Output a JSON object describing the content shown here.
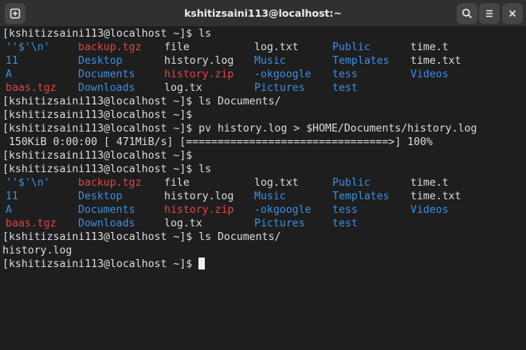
{
  "window": {
    "title": "kshitizsaini113@localhost:~",
    "buttons": [
      {
        "name": "new-tab",
        "icon": "new-tab-icon"
      },
      {
        "name": "search",
        "icon": "search-icon"
      },
      {
        "name": "menu",
        "icon": "hamburger-menu-icon"
      },
      {
        "name": "close",
        "icon": "close-icon"
      }
    ]
  },
  "colors": {
    "background": "#1e1e1e",
    "titlebar": "#303030",
    "directory": "#3c8fe0",
    "archive": "#e04545",
    "text": "#dcdcdc"
  },
  "terminal": {
    "prompt": "[kshitizsaini113@localhost ~]$",
    "lines": [
      {
        "type": "cmd",
        "text": "[kshitizsaini113@localhost ~]$ ls"
      },
      {
        "type": "ls",
        "cells": [
          {
            "text": "''$'\\n'",
            "kind": "dir"
          },
          {
            "text": "backup.tgz",
            "kind": "arc"
          },
          {
            "text": "file",
            "kind": "fil"
          },
          {
            "text": "log.txt",
            "kind": "fil"
          },
          {
            "text": "Public",
            "kind": "dir"
          },
          {
            "text": "time.t",
            "kind": "fil"
          }
        ]
      },
      {
        "type": "ls",
        "cells": [
          {
            "text": "11",
            "kind": "dir"
          },
          {
            "text": "Desktop",
            "kind": "dir"
          },
          {
            "text": "history.log",
            "kind": "fil"
          },
          {
            "text": "Music",
            "kind": "dir"
          },
          {
            "text": "Templates",
            "kind": "dir"
          },
          {
            "text": "time.txt",
            "kind": "fil"
          }
        ]
      },
      {
        "type": "ls",
        "cells": [
          {
            "text": "A",
            "kind": "dir"
          },
          {
            "text": "Documents",
            "kind": "dir"
          },
          {
            "text": "history.zip",
            "kind": "arc"
          },
          {
            "text": "-okgoogle",
            "kind": "dir"
          },
          {
            "text": "tess",
            "kind": "dir"
          },
          {
            "text": "Videos",
            "kind": "dir"
          }
        ]
      },
      {
        "type": "ls",
        "cells": [
          {
            "text": "baas.tgz",
            "kind": "arc"
          },
          {
            "text": "Downloads",
            "kind": "dir"
          },
          {
            "text": "log.tx",
            "kind": "fil"
          },
          {
            "text": "Pictures",
            "kind": "dir"
          },
          {
            "text": "test",
            "kind": "dir"
          },
          {
            "text": "",
            "kind": "fil"
          }
        ]
      },
      {
        "type": "cmd",
        "text": "[kshitizsaini113@localhost ~]$ ls Documents/"
      },
      {
        "type": "cmd",
        "text": "[kshitizsaini113@localhost ~]$"
      },
      {
        "type": "cmd",
        "text": "[kshitizsaini113@localhost ~]$ pv history.log > $HOME/Documents/history.log"
      },
      {
        "type": "cmd",
        "text": " 150KiB 0:00:00 [ 471MiB/s] [================================>] 100%"
      },
      {
        "type": "cmd",
        "text": "[kshitizsaini113@localhost ~]$"
      },
      {
        "type": "cmd",
        "text": "[kshitizsaini113@localhost ~]$ ls"
      },
      {
        "type": "ls",
        "cells": [
          {
            "text": "''$'\\n'",
            "kind": "dir"
          },
          {
            "text": "backup.tgz",
            "kind": "arc"
          },
          {
            "text": "file",
            "kind": "fil"
          },
          {
            "text": "log.txt",
            "kind": "fil"
          },
          {
            "text": "Public",
            "kind": "dir"
          },
          {
            "text": "time.t",
            "kind": "fil"
          }
        ]
      },
      {
        "type": "ls",
        "cells": [
          {
            "text": "11",
            "kind": "dir"
          },
          {
            "text": "Desktop",
            "kind": "dir"
          },
          {
            "text": "history.log",
            "kind": "fil"
          },
          {
            "text": "Music",
            "kind": "dir"
          },
          {
            "text": "Templates",
            "kind": "dir"
          },
          {
            "text": "time.txt",
            "kind": "fil"
          }
        ]
      },
      {
        "type": "ls",
        "cells": [
          {
            "text": "A",
            "kind": "dir"
          },
          {
            "text": "Documents",
            "kind": "dir"
          },
          {
            "text": "history.zip",
            "kind": "arc"
          },
          {
            "text": "-okgoogle",
            "kind": "dir"
          },
          {
            "text": "tess",
            "kind": "dir"
          },
          {
            "text": "Videos",
            "kind": "dir"
          }
        ]
      },
      {
        "type": "ls",
        "cells": [
          {
            "text": "baas.tgz",
            "kind": "arc"
          },
          {
            "text": "Downloads",
            "kind": "dir"
          },
          {
            "text": "log.tx",
            "kind": "fil"
          },
          {
            "text": "Pictures",
            "kind": "dir"
          },
          {
            "text": "test",
            "kind": "dir"
          },
          {
            "text": "",
            "kind": "fil"
          }
        ]
      },
      {
        "type": "cmd",
        "text": "[kshitizsaini113@localhost ~]$ ls Documents/"
      },
      {
        "type": "cmd",
        "text": "history.log"
      },
      {
        "type": "prompt",
        "text": "[kshitizsaini113@localhost ~]$ "
      }
    ]
  }
}
